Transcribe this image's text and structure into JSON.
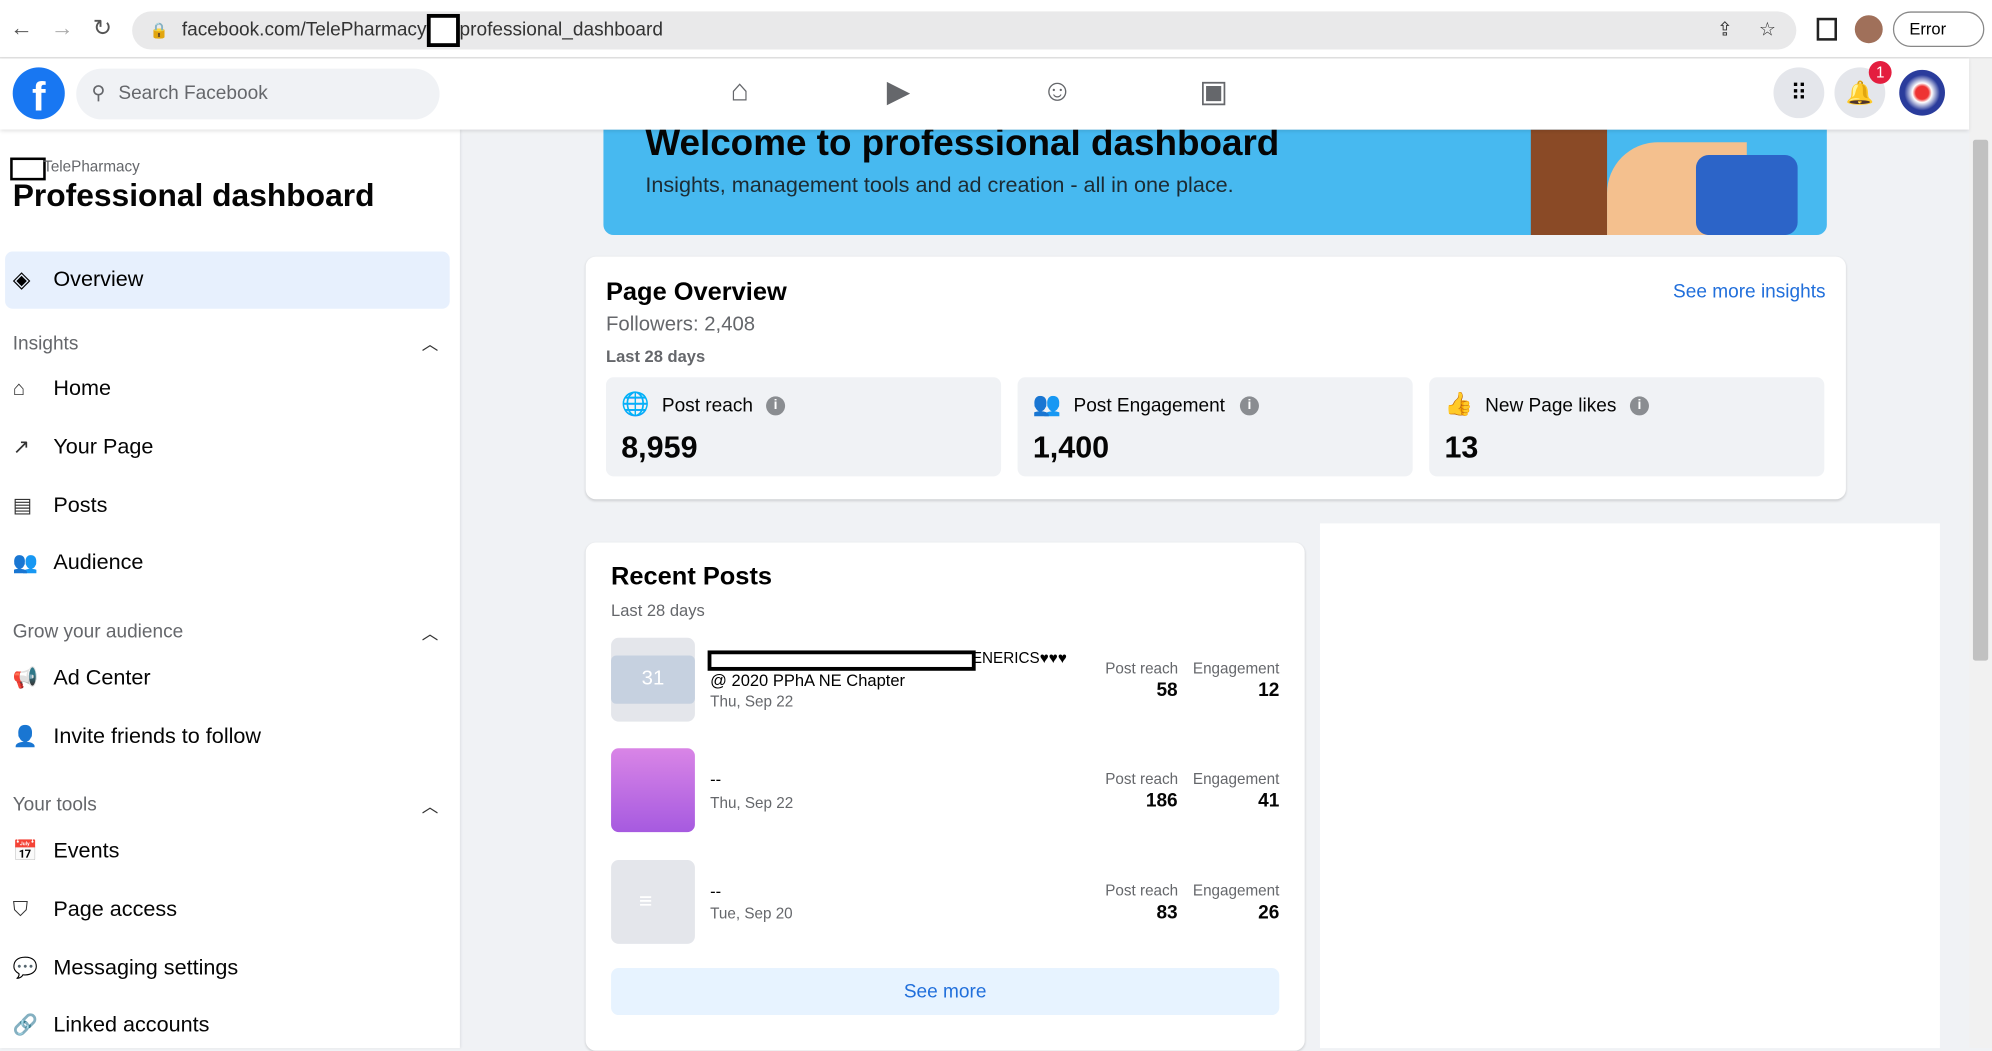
{
  "browser": {
    "url_prefix": "facebook.com/TelePharmacy",
    "url_suffix": "professional_dashboard",
    "profile_button": "Error"
  },
  "header": {
    "logo": "f",
    "search_placeholder": "Search Facebook",
    "notification_count": "1"
  },
  "sidebar": {
    "page_name": "TelePharmacy",
    "title": "Professional dashboard",
    "overview": "Overview",
    "sections": [
      {
        "label": "Insights",
        "items": [
          "Home",
          "Your Page",
          "Posts",
          "Audience"
        ]
      },
      {
        "label": "Grow your audience",
        "items": [
          "Ad Center",
          "Invite friends to follow"
        ]
      },
      {
        "label": "Your tools",
        "items": [
          "Events",
          "Page access",
          "Messaging settings",
          "Linked accounts"
        ]
      }
    ]
  },
  "banner": {
    "title": "Welcome to professional dashboard",
    "subtitle": "Insights, management tools and ad creation - all in one place."
  },
  "overview": {
    "title": "Page Overview",
    "followers": "Followers: 2,408",
    "period": "Last 28 days",
    "see_more": "See more insights",
    "stats": [
      {
        "label": "Post reach",
        "value": "8,959"
      },
      {
        "label": "Post Engagement",
        "value": "1,400"
      },
      {
        "label": "New Page likes",
        "value": "13"
      }
    ]
  },
  "recent": {
    "title": "Recent Posts",
    "period": "Last 28 days",
    "reach_label": "Post reach",
    "engagement_label": "Engagement",
    "see_more": "See more",
    "posts": [
      {
        "title": "ENERICS♥♥♥",
        "subtitle": "@ 2020 PPhA NE Chapter",
        "date": "Thu, Sep 22",
        "reach": "58",
        "engagement": "12"
      },
      {
        "title": "--",
        "date": "Thu, Sep 22",
        "reach": "186",
        "engagement": "41"
      },
      {
        "title": "--",
        "date": "Tue, Sep 20",
        "reach": "83",
        "engagement": "26"
      }
    ]
  }
}
